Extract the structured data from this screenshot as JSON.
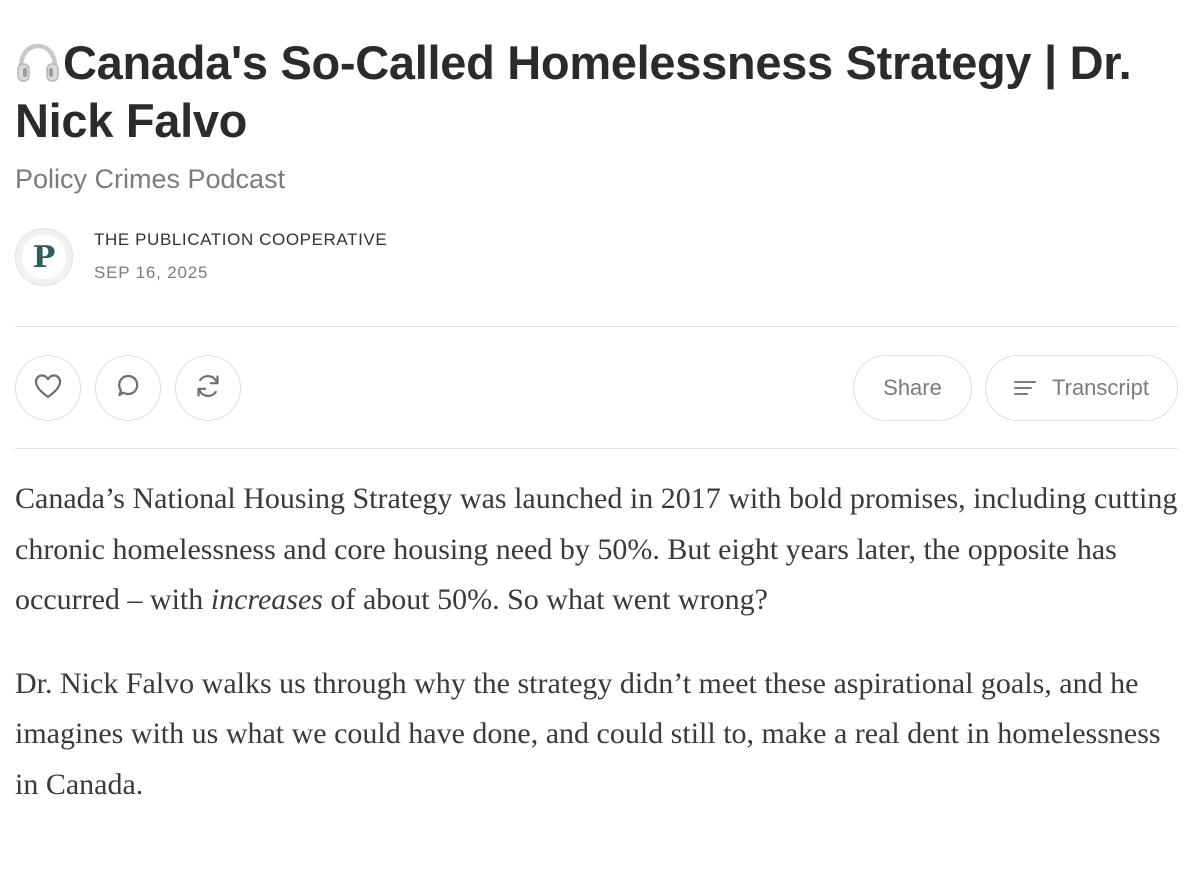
{
  "post": {
    "title": "Canada's So-Called Homelessness Strategy | Dr. Nick Falvo",
    "title_icon": "headphones-icon",
    "subtitle": "Policy Crimes Podcast",
    "author": "THE PUBLICATION COOPERATIVE",
    "date": "SEP 16, 2025",
    "avatar_letter": "P"
  },
  "actions": {
    "like_icon": "heart-icon",
    "comment_icon": "comment-icon",
    "restack_icon": "restack-icon",
    "share_label": "Share",
    "transcript_label": "Transcript",
    "transcript_icon": "lines-icon"
  },
  "body": {
    "p1_before": "Canada’s National Housing Strategy was launched in 2017 with bold promises, including cutting chronic homelessness and core housing need by 50%. But eight years later, the opposite has occurred – with ",
    "p1_emphasis": "increases",
    "p1_after": " of about 50%. So what went wrong?",
    "p2": "Dr. Nick Falvo walks us through why the strategy didn’t meet these aspirational goals, and he imagines with us what we could have done, and could still to, make a real dent in homelessness in Canada."
  },
  "colors": {
    "text": "#2b2b2b",
    "muted": "#7b7b7b",
    "border": "#dedede",
    "avatar_green": "#2f5f59"
  }
}
